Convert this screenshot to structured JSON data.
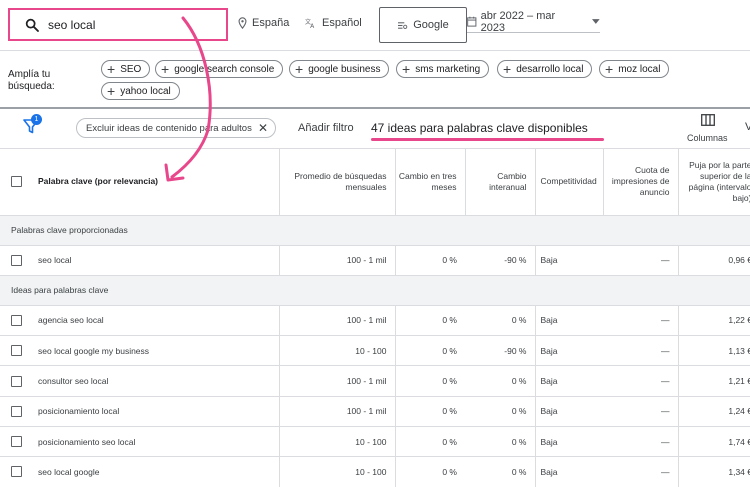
{
  "topbar": {
    "search_value": "seo local",
    "location": "España",
    "language": "Español",
    "network": "Google",
    "date_range": "abr 2022 – mar 2023"
  },
  "broaden": {
    "label": "Amplía tu búsqueda:",
    "chips": [
      "SEO",
      "google search console",
      "google business",
      "sms marketing",
      "desarrollo local",
      "moz local",
      "yahoo local"
    ]
  },
  "filterbar": {
    "filter_count": "1",
    "exclude_chip": "Excluir ideas de contenido para adultos",
    "add_filter": "Añadir filtro",
    "ideas_count": "47 ideas para palabras clave disponibles",
    "columns": "Columnas",
    "cut_text": "V"
  },
  "table": {
    "headers": {
      "keyword": "Palabra clave (por relevancia)",
      "avg": "Promedio de búsquedas mensuales",
      "change3": "Cambio en tres meses",
      "yoy": "Cambio interanual",
      "competition": "Competitividad",
      "share": "Cuota de impresiones de anuncio",
      "bid": "Puja por la parte superior de la página (intervalo bajo)"
    },
    "groups": [
      {
        "title": "Palabras clave proporcionadas",
        "rows": [
          {
            "keyword": "seo local",
            "avg": "100 - 1 mil",
            "change3": "0 %",
            "yoy": "-90 %",
            "competition": "Baja",
            "share": "—",
            "bid": "0,96 €"
          }
        ]
      },
      {
        "title": "Ideas para palabras clave",
        "rows": [
          {
            "keyword": "agencia seo local",
            "avg": "100 - 1 mil",
            "change3": "0 %",
            "yoy": "0 %",
            "competition": "Baja",
            "share": "—",
            "bid": "1,22 €"
          },
          {
            "keyword": "seo local google my business",
            "avg": "10 - 100",
            "change3": "0 %",
            "yoy": "-90 %",
            "competition": "Baja",
            "share": "—",
            "bid": "1,13 €"
          },
          {
            "keyword": "consultor seo local",
            "avg": "100 - 1 mil",
            "change3": "0 %",
            "yoy": "0 %",
            "competition": "Baja",
            "share": "—",
            "bid": "1,21 €"
          },
          {
            "keyword": "posicionamiento local",
            "avg": "100 - 1 mil",
            "change3": "0 %",
            "yoy": "0 %",
            "competition": "Baja",
            "share": "—",
            "bid": "1,24 €"
          },
          {
            "keyword": "posicionamiento seo local",
            "avg": "10 - 100",
            "change3": "0 %",
            "yoy": "0 %",
            "competition": "Baja",
            "share": "—",
            "bid": "1,74 €"
          },
          {
            "keyword": "seo local google",
            "avg": "10 - 100",
            "change3": "0 %",
            "yoy": "0 %",
            "competition": "Baja",
            "share": "—",
            "bid": "1,34 €"
          }
        ]
      }
    ]
  },
  "colors": {
    "highlight": "#e8478b",
    "accent": "#1a73e8"
  }
}
